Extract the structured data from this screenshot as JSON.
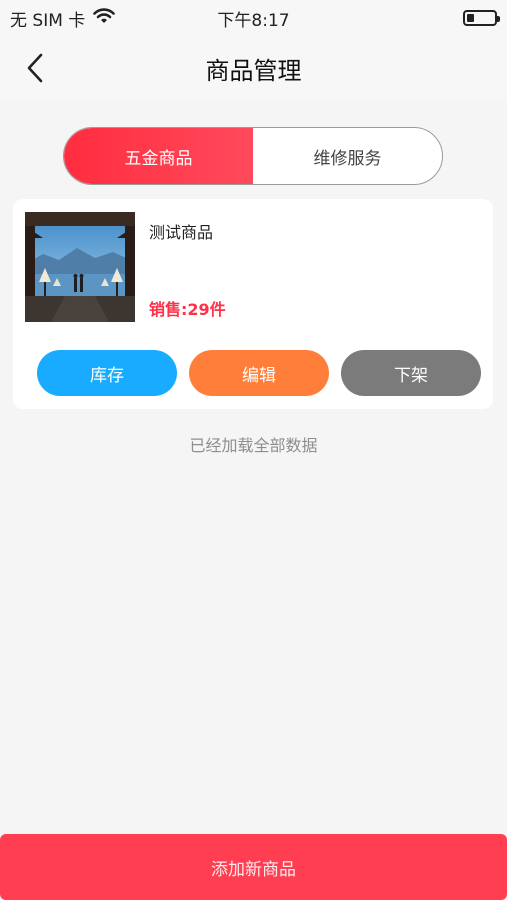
{
  "status_bar": {
    "carrier": "无 SIM 卡",
    "time": "下午8:17",
    "battery_level": 0.25,
    "wifi_icon": "wifi-icon",
    "battery_icon": "battery-icon"
  },
  "nav": {
    "title": "商品管理",
    "back_icon": "chevron-left-icon"
  },
  "tabs": [
    {
      "label": "五金商品",
      "active": true
    },
    {
      "label": "维修服务",
      "active": false
    }
  ],
  "products": [
    {
      "name": "测试商品",
      "sales": "销售:29件",
      "image": "product-thumbnail",
      "actions": {
        "stock": "库存",
        "edit": "编辑",
        "off_shelf": "下架"
      }
    }
  ],
  "list_footer": "已经加载全部数据",
  "add_button": "添加新商品",
  "colors": {
    "accent": "#ff3e52",
    "stock_button": "#19abff",
    "edit_button": "#ff7f3a",
    "off_shelf_button": "#7b7b7b"
  }
}
